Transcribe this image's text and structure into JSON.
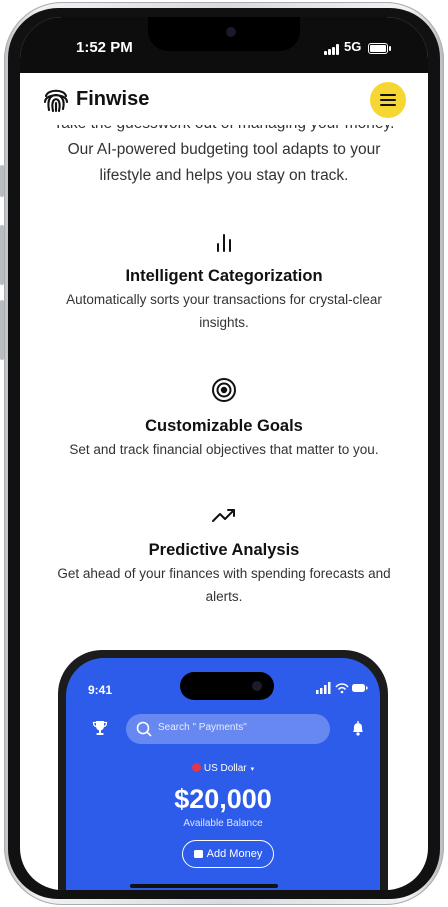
{
  "status_bar": {
    "time": "1:52 PM",
    "network": "5G"
  },
  "header": {
    "brand": "Finwise",
    "logo_icon": "fingerprint-icon",
    "menu_icon": "hamburger-menu-icon",
    "accent": "#f6d630"
  },
  "intro": {
    "partial_line": "Take the guesswork out of managing your money.",
    "text": "Our AI-powered budgeting tool adapts to your lifestyle and helps you stay on track."
  },
  "features": [
    {
      "icon": "bar-chart-icon",
      "title": "Intelligent Categorization",
      "description": "Automatically sorts your transactions for crystal-clear insights."
    },
    {
      "icon": "target-icon",
      "title": "Customizable Goals",
      "description": "Set and track financial objectives that matter to you."
    },
    {
      "icon": "trend-up-icon",
      "title": "Predictive Analysis",
      "description": "Get ahead of your finances with spending forecasts and alerts."
    }
  ],
  "mockup": {
    "time": "9:41",
    "search_placeholder": "Search \" Payments\"",
    "currency": "US Dollar",
    "balance": "$20,000",
    "balance_label": "Available Balance",
    "add_money": "Add Money",
    "bg_color": "#2d5bea"
  }
}
